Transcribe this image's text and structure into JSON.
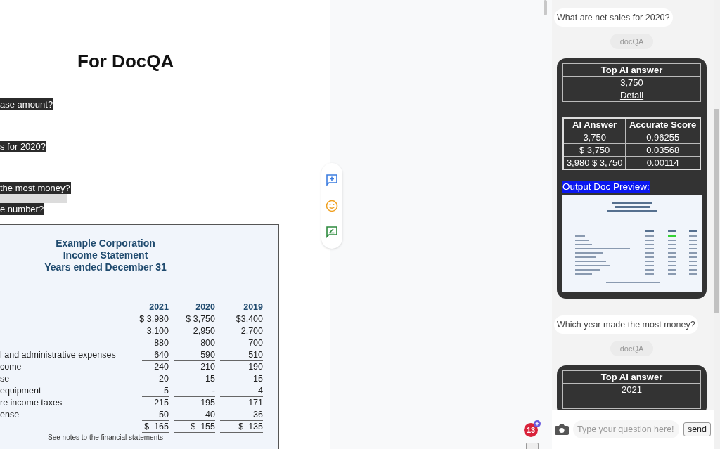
{
  "document": {
    "heading": "For DocQA",
    "questions": [
      {
        "text": "ase amount?",
        "highlighted": false
      },
      {
        "text": "s for 2020?",
        "highlighted": false
      },
      {
        "text": "the most money?",
        "highlighted": true
      },
      {
        "text": "e number?",
        "highlighted": false
      }
    ],
    "statement": {
      "title_lines": [
        "Example Corporation",
        "Income Statement",
        "Years ended December 31"
      ],
      "years": [
        "2021",
        "2020",
        "2019"
      ],
      "rows": [
        {
          "values": [
            "$ 3,980",
            "$ 3,750",
            "$3,400"
          ]
        },
        {
          "values": [
            "3,100",
            "2,950",
            "2,700"
          ],
          "underlined": true
        },
        {
          "values": [
            "880",
            "800",
            "700"
          ]
        },
        {
          "label": "l and administrative expenses",
          "values": [
            "640",
            "590",
            "510"
          ],
          "underlined": true
        },
        {
          "label": "come",
          "values": [
            "240",
            "210",
            "190"
          ]
        },
        {
          "label": "se",
          "values": [
            "20",
            "15",
            "15"
          ]
        },
        {
          "label": "equipment",
          "values": [
            "5",
            "-",
            "4"
          ],
          "underlined": true
        },
        {
          "label": "re income taxes",
          "values": [
            "215",
            "195",
            "171"
          ]
        },
        {
          "label": "ense",
          "values": [
            "50",
            "40",
            "36"
          ],
          "underlined": true
        },
        {
          "values": [
            "$  165",
            "$  155",
            "$  135"
          ],
          "double_underlined": true
        }
      ],
      "footnote": "See notes to the financial statements"
    }
  },
  "notification_badge": "13",
  "chat": {
    "messages": [
      {
        "kind": "question",
        "text": "What are net sales for 2020?"
      },
      {
        "kind": "sender",
        "text": "docQA"
      },
      {
        "kind": "answer",
        "top_answer": {
          "title": "Top AI answer",
          "value": "3,750",
          "link": "Detail"
        },
        "scores": {
          "columns": [
            "AI Answer",
            "Accurate Score"
          ],
          "rows": [
            [
              "3,750",
              "0.96255"
            ],
            [
              "$ 3,750",
              "0.03568"
            ],
            [
              "3,980 $ 3,750",
              "0.00114"
            ]
          ]
        },
        "preview_label": "Output Doc Preview:"
      },
      {
        "kind": "question",
        "text": "Which year made the most money?"
      },
      {
        "kind": "sender",
        "text": "docQA"
      },
      {
        "kind": "answer",
        "top_answer": {
          "title": "Top AI answer",
          "value": "2021"
        }
      }
    ],
    "input": {
      "placeholder": "Type your question here!",
      "button": "send"
    }
  }
}
